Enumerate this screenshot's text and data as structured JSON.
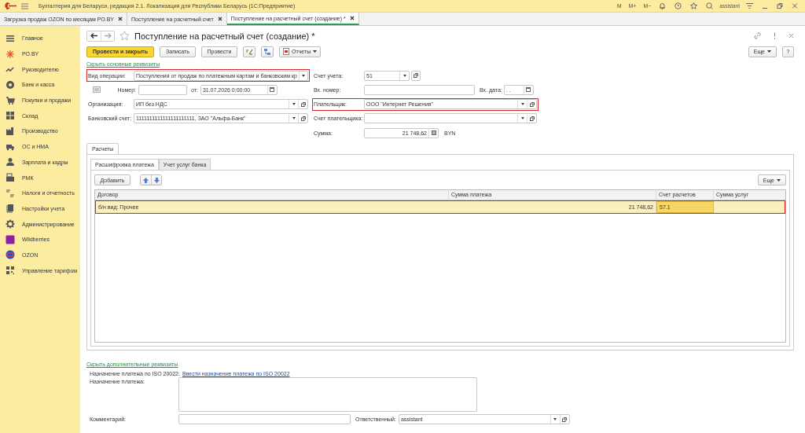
{
  "app": {
    "title": "Бухгалтерия для Беларуси, редакция 2.1. Локализация для Республики Беларусь  (1С:Предприятие)",
    "memory_buttons": [
      "M",
      "M+",
      "M−"
    ],
    "user": "assistant"
  },
  "open_tabs": [
    {
      "label": "Загрузка продаж OZON по месяцам РО.BY",
      "selected": false
    },
    {
      "label": "Поступление на расчетный счет",
      "selected": false
    },
    {
      "label": "Поступление на расчетный счет (создание) *",
      "selected": true
    }
  ],
  "sidebar": [
    {
      "label": "Главное"
    },
    {
      "label": "РО.BY"
    },
    {
      "label": "Руководителю"
    },
    {
      "label": "Банк и касса"
    },
    {
      "label": "Покупки и продажи"
    },
    {
      "label": "Склад"
    },
    {
      "label": "Производство"
    },
    {
      "label": "ОС и НМА"
    },
    {
      "label": "Зарплата и кадры"
    },
    {
      "label": "РМК"
    },
    {
      "label": "Налоги и отчетность"
    },
    {
      "label": "Настройки учета"
    },
    {
      "label": "Администрирование"
    },
    {
      "label": "Wildberries"
    },
    {
      "label": "OZON"
    },
    {
      "label": "Управление тарифом"
    }
  ],
  "document": {
    "title": "Поступление на расчетный счет (создание) *",
    "post_close": "Провести и закрыть",
    "save": "Записать",
    "post": "Провести",
    "reports": "Отчеты",
    "more": "Еще",
    "help": "?"
  },
  "main_fields": {
    "hide_link": "Скрыть основные реквизиты",
    "operation": {
      "label": "Вид операции:",
      "value": "Поступления от продаж по платежным картам и банковским кр",
      "highlighted": true
    },
    "number": {
      "label": "Номер:"
    },
    "date": {
      "label": "от:",
      "value": "31.07.2026  0:00:00"
    },
    "organization": {
      "label": "Организация:",
      "value": "ИП без НДС"
    },
    "bank_account": {
      "label": "Банковский счет:",
      "value": "1111111111111111111111, ЗАО \"Альфа-Банк\""
    },
    "account": {
      "label": "Счет учета:",
      "value": "51"
    },
    "in_number": {
      "label": "Вх. номер:"
    },
    "in_date": {
      "label": "Вх. дата:",
      "value": " .  ."
    },
    "payer": {
      "label": "Плательщик:",
      "value": "ООО \"Интернет Решения\"",
      "highlighted": true
    },
    "payer_account": {
      "label": "Счет плательщика:"
    },
    "sum": {
      "label": "Сумма:",
      "value": "21 748,62",
      "currency": "BYN"
    }
  },
  "section_tabs": [
    {
      "label": "Расчеты",
      "selected": true
    }
  ],
  "sub_tabs": [
    {
      "label": "Расшифровка платежа",
      "selected": true
    },
    {
      "label": "Учет услуг банка",
      "selected": false
    }
  ],
  "table": {
    "add_button": "Добавить",
    "more_button": "Еще",
    "columns": [
      "Договор",
      "Сумма платежа",
      "Счет расчетов",
      "Сумма услуг"
    ],
    "rows": [
      {
        "contract": "б/н вид: Прочее",
        "amount": "21 748,62",
        "account": "57.1",
        "selected": true,
        "highlighted": true
      }
    ]
  },
  "footer": {
    "hide_link": "Скрыть дополнительные реквизиты",
    "iso_label": "Назначение платежа по ISO 20022:",
    "iso_link": "Ввести назначение платежа по ISO 20022",
    "purpose_label": "Назначение платежа:",
    "comment_label": "Комментарий:",
    "responsible": {
      "label": "Ответственный:",
      "value": "assistant"
    }
  }
}
